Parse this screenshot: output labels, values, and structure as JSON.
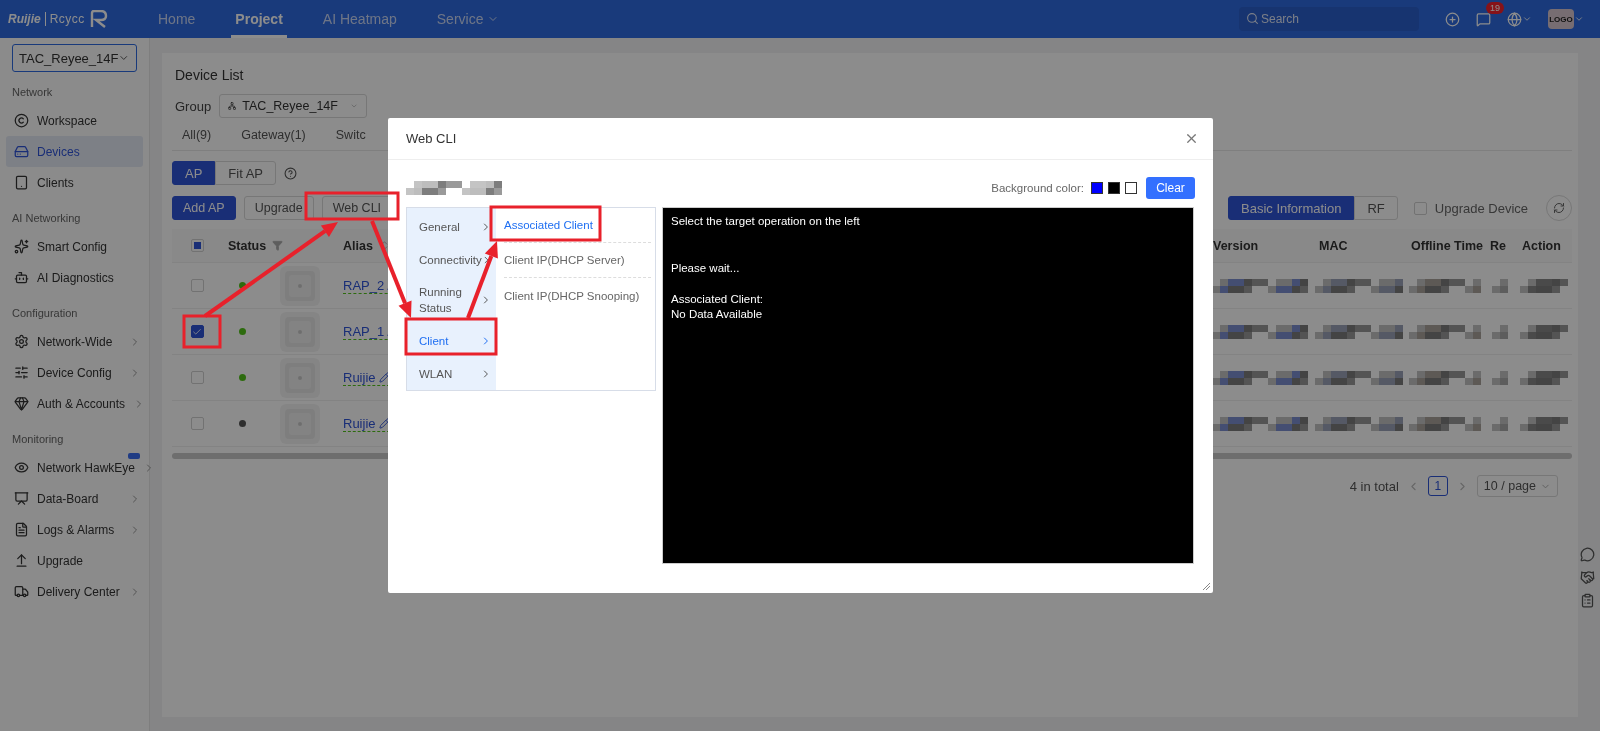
{
  "top_bar": {
    "brand": "Ruijie",
    "sub_brand": "Rcycc",
    "nav": [
      {
        "label": "Home",
        "selected": false,
        "dropdown": false
      },
      {
        "label": "Project",
        "selected": true,
        "dropdown": false
      },
      {
        "label": "AI Heatmap",
        "selected": false,
        "dropdown": false
      },
      {
        "label": "Service",
        "selected": false,
        "dropdown": true
      }
    ],
    "search": {
      "placeholder": "Search"
    },
    "notifications": {
      "count": "19"
    },
    "avatar": {
      "label": "LOGO"
    }
  },
  "sidebar": {
    "project": "TAC_Reyee_14F",
    "sections": [
      {
        "title": "Network",
        "items": [
          {
            "label": "Workspace",
            "selected": false,
            "expandable": false,
            "badge": false
          },
          {
            "label": "Devices",
            "selected": true,
            "expandable": false,
            "badge": false
          },
          {
            "label": "Clients",
            "selected": false,
            "expandable": false,
            "badge": false
          }
        ]
      },
      {
        "title": "AI Networking",
        "items": [
          {
            "label": "Smart Config",
            "selected": false,
            "expandable": false,
            "badge": false
          },
          {
            "label": "AI Diagnostics",
            "selected": false,
            "expandable": false,
            "badge": false
          }
        ]
      },
      {
        "title": "Configuration",
        "items": [
          {
            "label": "Network-Wide",
            "selected": false,
            "expandable": true,
            "badge": false
          },
          {
            "label": "Device Config",
            "selected": false,
            "expandable": true,
            "badge": false
          },
          {
            "label": "Auth & Accounts",
            "selected": false,
            "expandable": true,
            "badge": false
          }
        ]
      },
      {
        "title": "Monitoring",
        "items": [
          {
            "label": "Network HawkEye",
            "selected": false,
            "expandable": true,
            "badge": true
          },
          {
            "label": "Data-Board",
            "selected": false,
            "expandable": true,
            "badge": false
          },
          {
            "label": "Logs & Alarms",
            "selected": false,
            "expandable": true,
            "badge": false
          },
          {
            "label": "Upgrade",
            "selected": false,
            "expandable": false,
            "badge": false
          },
          {
            "label": "Delivery Center",
            "selected": false,
            "expandable": true,
            "badge": false
          }
        ]
      }
    ]
  },
  "device_list": {
    "title": "Device List",
    "group": {
      "label": "Group",
      "value": "TAC_Reyee_14F"
    },
    "type_tabs": [
      {
        "label": "All(9)",
        "selected": false
      },
      {
        "label": "Gateway(1)",
        "selected": false
      },
      {
        "label": "Switc",
        "selected": false
      }
    ],
    "mode_tabs": [
      {
        "label": "AP",
        "selected": true
      },
      {
        "label": "Fit AP",
        "selected": false
      }
    ],
    "actions": [
      {
        "label": "Add AP",
        "kind": "primary"
      },
      {
        "label": "Upgrade",
        "kind": "default"
      },
      {
        "label": "Web CLI",
        "kind": "default"
      }
    ],
    "view_tabs": [
      {
        "label": "Basic Information",
        "selected": true
      },
      {
        "label": "RF",
        "selected": false
      }
    ],
    "upgrade_device": {
      "label": "Upgrade Device",
      "checked": false
    },
    "table": {
      "select_all": {
        "indeterminate": true
      },
      "columns": [
        "Status",
        "Alias",
        "Version",
        "MAC",
        "Offline Time",
        "Re",
        "Action"
      ],
      "rows": [
        {
          "checked": false,
          "online": true,
          "alias": "RAP_2"
        },
        {
          "checked": true,
          "online": true,
          "alias": "RAP_1"
        },
        {
          "checked": false,
          "online": true,
          "alias": "Ruijie"
        },
        {
          "checked": false,
          "online": false,
          "alias": "Ruijie"
        }
      ]
    },
    "pagination": {
      "total": "4 in total",
      "pages": [
        {
          "label": "1",
          "selected": true
        }
      ],
      "page_size": "10 / page"
    }
  },
  "web_cli": {
    "title": "Web CLI",
    "background_label": "Background color:",
    "swatches": [
      {
        "color": "#0000ff"
      },
      {
        "color": "#000000"
      },
      {
        "color": "#ffffff"
      }
    ],
    "clear": "Clear",
    "menu": [
      {
        "label": "General",
        "selected": false
      },
      {
        "label": "Connectivity",
        "selected": false
      },
      {
        "label": "Running Status",
        "selected": false
      },
      {
        "label": "Client",
        "selected": true
      },
      {
        "label": "WLAN",
        "selected": false
      }
    ],
    "submenu": [
      {
        "label": "Associated Client",
        "selected": true
      },
      {
        "label": "Client IP(DHCP Server)",
        "selected": false
      },
      {
        "label": "Client IP(DHCP Snooping)",
        "selected": false
      }
    ],
    "output": "Select the target operation on the left\n\n\nPlease wait...\n\nAssociated Client:\nNo Data Available"
  }
}
